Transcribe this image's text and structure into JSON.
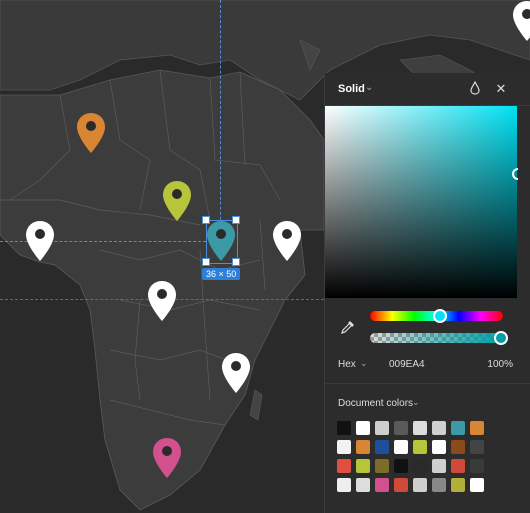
{
  "canvas": {
    "selection_size": "36 × 50",
    "selected_pin_color": "#3b9aa6",
    "pins": [
      {
        "name": "orange-pin",
        "color": "#d98634"
      },
      {
        "name": "yellow-pin",
        "color": "#b6c53a"
      },
      {
        "name": "teal-pin-selected",
        "color": "#3b9aa6"
      },
      {
        "name": "white-pin-west",
        "color": "#ffffff"
      },
      {
        "name": "white-pin-east",
        "color": "#ffffff"
      },
      {
        "name": "white-pin-center",
        "color": "#ffffff"
      },
      {
        "name": "white-pin-south",
        "color": "#ffffff"
      },
      {
        "name": "pink-pin",
        "color": "#d2508d"
      },
      {
        "name": "white-pin-topright",
        "color": "#ffffff"
      }
    ]
  },
  "color_panel": {
    "mode_label": "Solid",
    "icons": {
      "mode_dropdown": "chevron-down-icon",
      "style": "droplet-icon",
      "close": "close-icon",
      "eyedropper": "eyedropper-icon"
    },
    "current_color_hex": "#009ea4",
    "hue_level": 0.53,
    "alpha_level": 1.0,
    "format_label": "Hex",
    "hex_value": "009EA4",
    "opacity_value": "100%",
    "document_colors_label": "Document colors",
    "document_colors": [
      "#111111",
      "#ffffff",
      "#cfcfcf",
      "#5a5a5a",
      "#dcdcdc",
      "#cfcfcf",
      "#3b9aa6",
      "#d98634",
      "#f2f2f2",
      "#d98634",
      "#1f4f9a",
      "#ffffff",
      "#b6c53a",
      "#ffffff",
      "#8a4a1a",
      "#444444",
      "#e05040",
      "#b6c53a",
      "#7a6d2a",
      "#111111",
      "#2a2a2a",
      "#cfcfcf",
      "#d04a3a",
      "#3a3a3a",
      "#eeeeee",
      "#dddddd",
      "#d2508d",
      "#d04a3a",
      "#cfcfcf",
      "#888888",
      "#b0b03a",
      "#ffffff"
    ]
  }
}
